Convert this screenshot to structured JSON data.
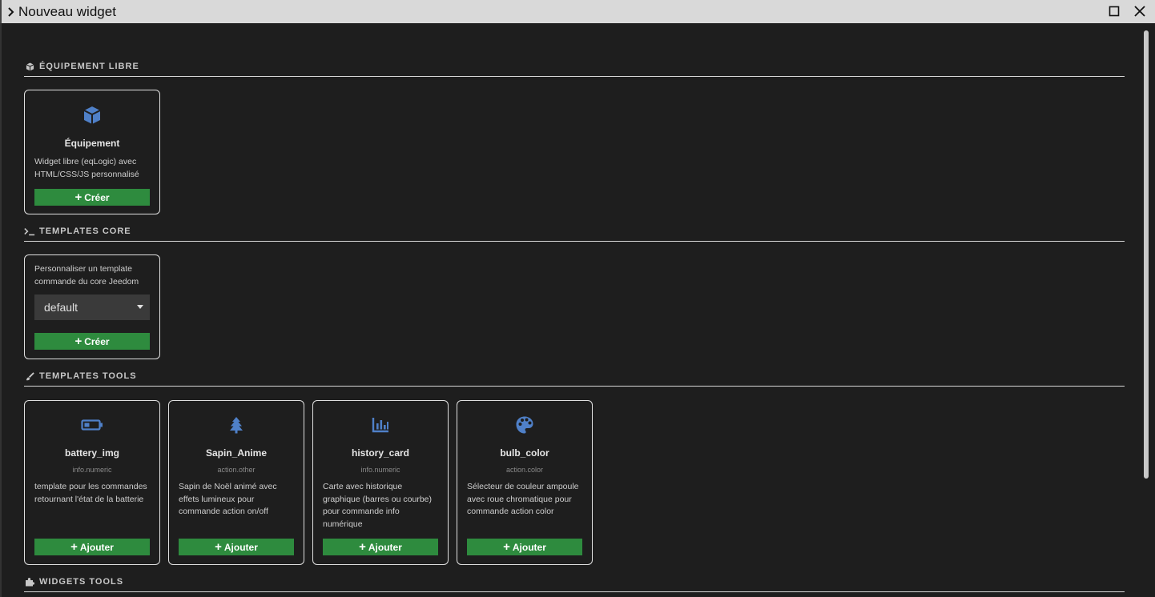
{
  "window": {
    "title": "Nouveau widget"
  },
  "sections": {
    "equipement": {
      "heading": "ÉQUIPEMENT LIBRE"
    },
    "core": {
      "heading": "TEMPLATES CORE"
    },
    "tools": {
      "heading": "TEMPLATES TOOLS"
    },
    "widgets": {
      "heading": "WIDGETS TOOLS"
    }
  },
  "equipement_card": {
    "title": "Équipement",
    "description": "Widget libre (eqLogic) avec HTML/CSS/JS personnalisé",
    "button_label": "Créer"
  },
  "core_card": {
    "description": "Personnaliser un template commande du core Jeedom",
    "select_value": "default",
    "button_label": "Créer"
  },
  "tool_cards": [
    {
      "title": "battery_img",
      "type": "info.numeric",
      "description": "template pour les commandes retournant l'état de la batterie",
      "button_label": "Ajouter",
      "icon": "battery-icon"
    },
    {
      "title": "Sapin_Anime",
      "type": "action.other",
      "description": "Sapin de Noël animé avec effets lumineux pour commande action on/off",
      "button_label": "Ajouter",
      "icon": "tree-icon"
    },
    {
      "title": "history_card",
      "type": "info.numeric",
      "description": "Carte avec historique graphique (barres ou courbe) pour commande info numérique",
      "button_label": "Ajouter",
      "icon": "chart-bar-icon"
    },
    {
      "title": "bulb_color",
      "type": "action.color",
      "description": "Sélecteur de couleur ampoule avec roue chromatique pour commande action color",
      "button_label": "Ajouter",
      "icon": "palette-icon"
    }
  ],
  "colors": {
    "background": "#1e1e1e",
    "accent_icon": "#4f80c8",
    "button_green": "#2e8b3e",
    "titlebar": "#d9d9d9"
  }
}
